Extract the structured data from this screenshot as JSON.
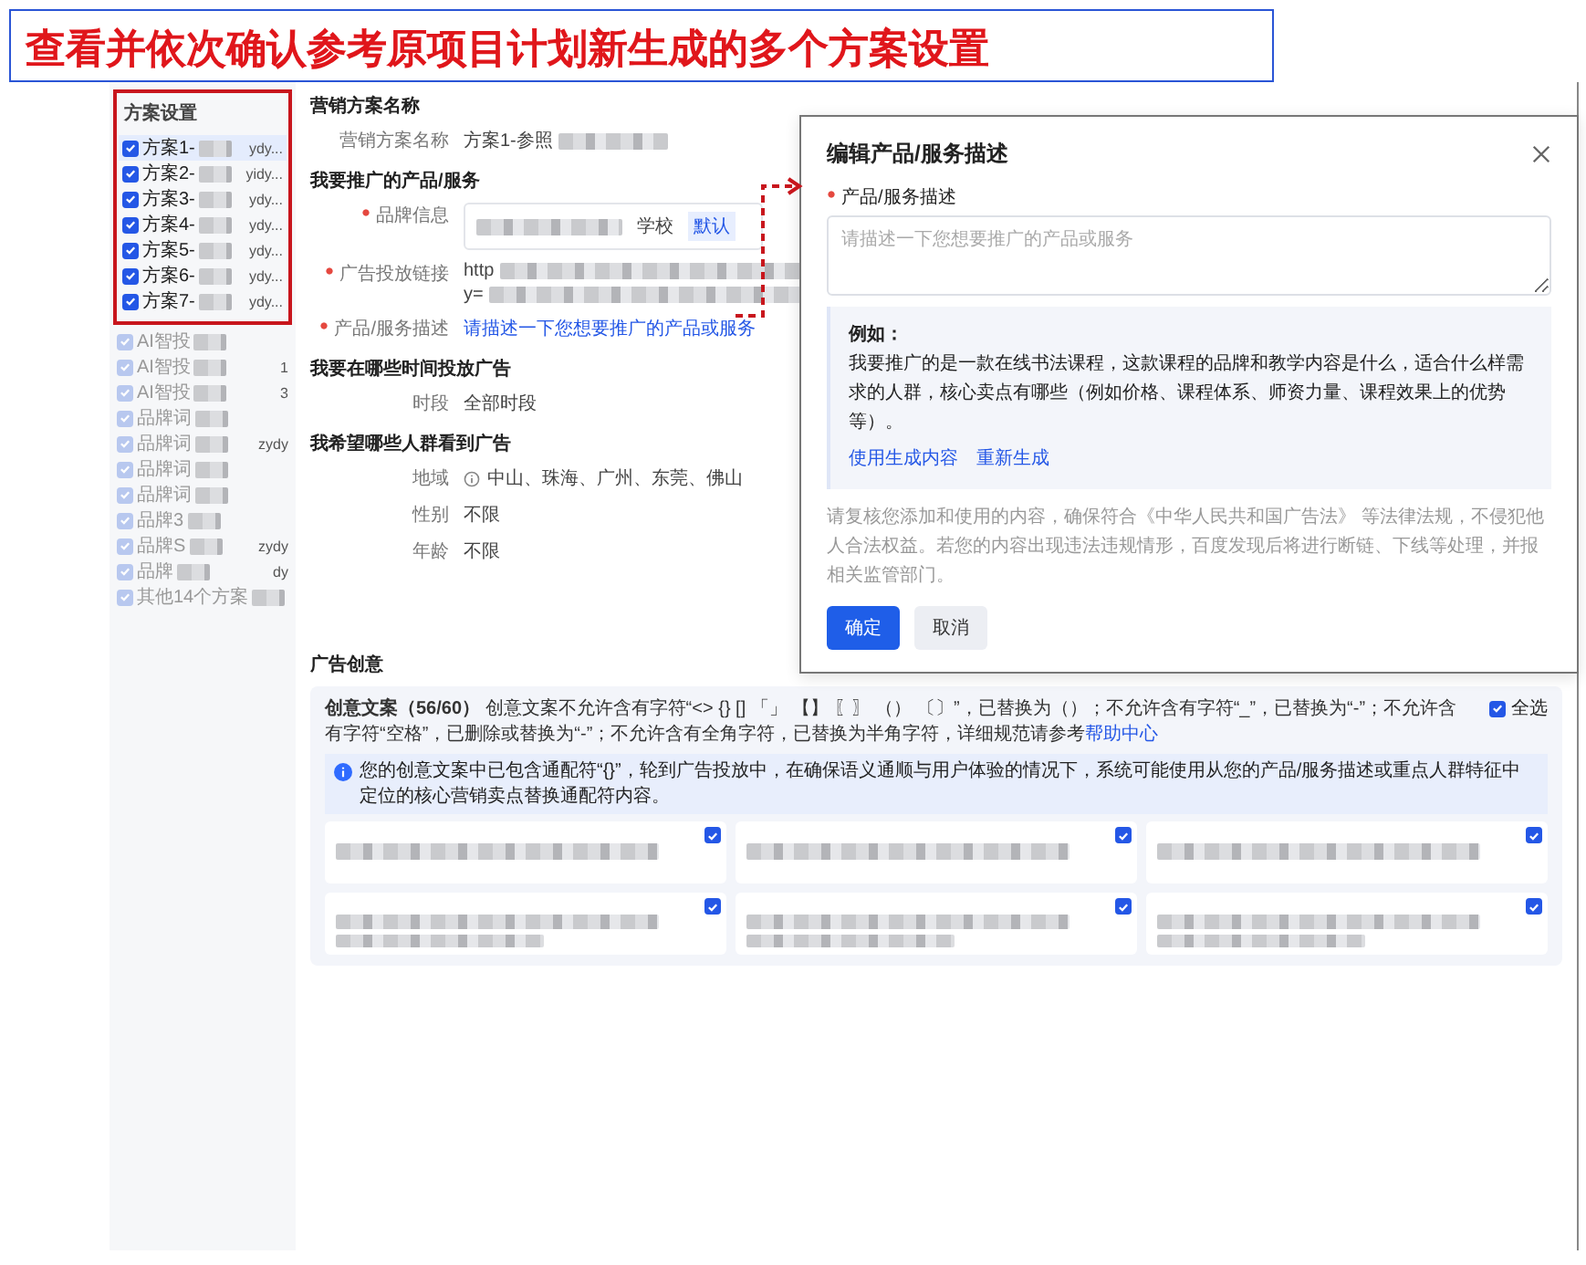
{
  "title": "查看并依次确认参考原项目计划新生成的多个方案设置",
  "sidebar": {
    "heading": "方案设置",
    "items": [
      {
        "label": "方案1-",
        "tail": "ydy...",
        "checked": true,
        "disabled": false,
        "selected": true,
        "highlighted": true
      },
      {
        "label": "方案2-",
        "tail": "yidy...",
        "checked": true,
        "disabled": false,
        "selected": false,
        "highlighted": true
      },
      {
        "label": "方案3-",
        "tail": "ydy...",
        "checked": true,
        "disabled": false,
        "selected": false,
        "highlighted": true
      },
      {
        "label": "方案4-",
        "tail": "ydy...",
        "checked": true,
        "disabled": false,
        "selected": false,
        "highlighted": true
      },
      {
        "label": "方案5-",
        "tail": "ydy...",
        "checked": true,
        "disabled": false,
        "selected": false,
        "highlighted": true
      },
      {
        "label": "方案6-",
        "tail": "ydy...",
        "checked": true,
        "disabled": false,
        "selected": false,
        "highlighted": true
      },
      {
        "label": "方案7-",
        "tail": "ydy...",
        "checked": true,
        "disabled": false,
        "selected": false,
        "highlighted": true
      },
      {
        "label": "AI智投",
        "checked": true,
        "disabled": true,
        "selected": false,
        "highlighted": false
      },
      {
        "label": "AI智投",
        "tail": "1",
        "checked": true,
        "disabled": true,
        "selected": false,
        "highlighted": false
      },
      {
        "label": "AI智投",
        "tail": "3",
        "checked": true,
        "disabled": true,
        "selected": false,
        "highlighted": false
      },
      {
        "label": "品牌词",
        "checked": true,
        "disabled": true,
        "selected": false,
        "highlighted": false
      },
      {
        "label": "品牌词",
        "tail": "zydy",
        "checked": true,
        "disabled": true,
        "selected": false,
        "highlighted": false
      },
      {
        "label": "品牌词",
        "checked": true,
        "disabled": true,
        "selected": false,
        "highlighted": false
      },
      {
        "label": "品牌词",
        "checked": true,
        "disabled": true,
        "selected": false,
        "highlighted": false
      },
      {
        "label": "品牌3",
        "checked": true,
        "disabled": true,
        "selected": false,
        "highlighted": false
      },
      {
        "label": "品牌S",
        "tail": "zydy",
        "checked": true,
        "disabled": true,
        "selected": false,
        "highlighted": false
      },
      {
        "label": "品牌",
        "tail": "dy",
        "checked": true,
        "disabled": true,
        "selected": false,
        "highlighted": false
      },
      {
        "label": "其他14个方案",
        "checked": true,
        "disabled": true,
        "selected": false,
        "highlighted": false
      }
    ]
  },
  "form": {
    "sections": [
      {
        "heading": "营销方案名称",
        "rows": [
          {
            "kind": "text",
            "label": "营销方案名称",
            "required": false,
            "value": "方案1-参照",
            "redacted": true
          }
        ]
      },
      {
        "heading": "我要推广的产品/服务",
        "rows": [
          {
            "kind": "brand",
            "label": "品牌信息",
            "required": true,
            "value": "学校",
            "tag": "默认"
          },
          {
            "kind": "url",
            "label": "广告投放链接",
            "required": true,
            "lines": [
              "http",
              "y="
            ]
          },
          {
            "kind": "link",
            "label": "产品/服务描述",
            "required": true,
            "value": "请描述一下您想要推广的产品或服务"
          }
        ]
      },
      {
        "heading": "我要在哪些时间投放广告",
        "rows": [
          {
            "kind": "text",
            "label": "时段",
            "required": false,
            "value": "全部时段",
            "redacted": false
          }
        ]
      },
      {
        "heading": "我希望哪些人群看到广告",
        "rows": [
          {
            "kind": "region",
            "label": "地域",
            "required": false,
            "value": "中山、珠海、广州、东莞、佛山"
          },
          {
            "kind": "text",
            "label": "性别",
            "required": false,
            "value": "不限",
            "redacted": false
          },
          {
            "kind": "text",
            "label": "年龄",
            "required": false,
            "value": "不限",
            "redacted": false
          }
        ]
      }
    ]
  },
  "creative": {
    "heading": "广告创意",
    "title": "创意文案（56/60）",
    "rule": "创意文案不允许含有字符“<> {} [] 「」 【】 〖〗 （） 〔〕”，已替换为（）；不允许含有字符“_”，已替换为“-”；不允许含有字符“空格”，已删除或替换为“-”；不允许含有全角字符，已替换为半角字符，详细规范请参考",
    "link": "帮助中心",
    "select_all": {
      "label": "全选",
      "checked": true
    },
    "notice": "您的创意文案中已包含通配符“{}”，轮到广告投放中，在确保语义通顺与用户体验的情况下，系统可能使用从您的产品/服务描述或重点人群特征中定位的核心营销卖点替换通配符内容。",
    "cards": [
      {
        "checked": true
      },
      {
        "checked": true
      },
      {
        "checked": true
      },
      {
        "checked": true
      },
      {
        "checked": true
      },
      {
        "checked": true
      }
    ]
  },
  "dialog": {
    "title": "编辑产品/服务描述",
    "field_label": "产品/服务描述",
    "required": true,
    "placeholder": "请描述一下您想要推广的产品或服务",
    "example_heading": "例如：",
    "example": "我要推广的是一款在线书法课程，这款课程的品牌和教学内容是什么，适合什么样需求的人群，核心卖点有哪些（例如价格、课程体系、师资力量、课程效果上的优势等）。",
    "actions": [
      "使用生成内容",
      "重新生成"
    ],
    "disclaimer": "请复核您添加和使用的内容，确保符合《中华人民共和国广告法》 等法律法规，不侵犯他人合法权益。若您的内容出现违法违规情形，百度发现后将进行断链、下线等处理，并报相关监管部门。",
    "buttons": [
      {
        "label": "确定",
        "kind": "primary"
      },
      {
        "label": "取消",
        "kind": "secondary"
      }
    ]
  }
}
